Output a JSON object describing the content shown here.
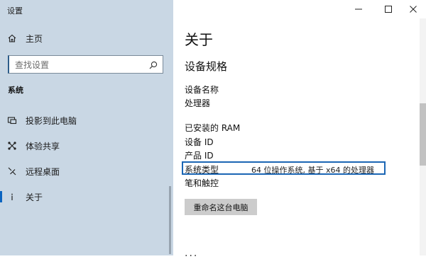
{
  "window": {
    "title": "设置",
    "minimize_icon": "minimize-icon",
    "maximize_icon": "maximize-icon",
    "close_icon": "close-icon"
  },
  "sidebar": {
    "home": {
      "label": "主页",
      "icon": "home-icon"
    },
    "search": {
      "placeholder": "查找设置",
      "value": "",
      "icon": "search-icon"
    },
    "section_header": "系统",
    "items": [
      {
        "label": "投影到此电脑",
        "icon": "projector-icon"
      },
      {
        "label": "体验共享",
        "icon": "share-icon"
      },
      {
        "label": "远程桌面",
        "icon": "remote-desktop-icon"
      },
      {
        "label": "关于",
        "icon": "info-icon",
        "selected": true
      }
    ],
    "background_color": "#c9d7e4",
    "accent_color": "#0b64c0"
  },
  "main": {
    "title": "关于",
    "subtitle": "设备规格",
    "specs": [
      {
        "label": "设备名称",
        "value": ""
      },
      {
        "label": "处理器",
        "value": ""
      },
      {
        "label": "已安装的 RAM",
        "value": ""
      },
      {
        "label": "设备 ID",
        "value": ""
      },
      {
        "label": "产品 ID",
        "value": ""
      },
      {
        "label": "系统类型",
        "value": "64 位操作系统, 基于 x64 的处理器",
        "highlighted": true
      },
      {
        "label": "笔和触控",
        "value": ""
      }
    ],
    "rename_button": "重命名这台电脑",
    "next_heading_partial": "...",
    "highlight_color": "#1b66b4"
  }
}
